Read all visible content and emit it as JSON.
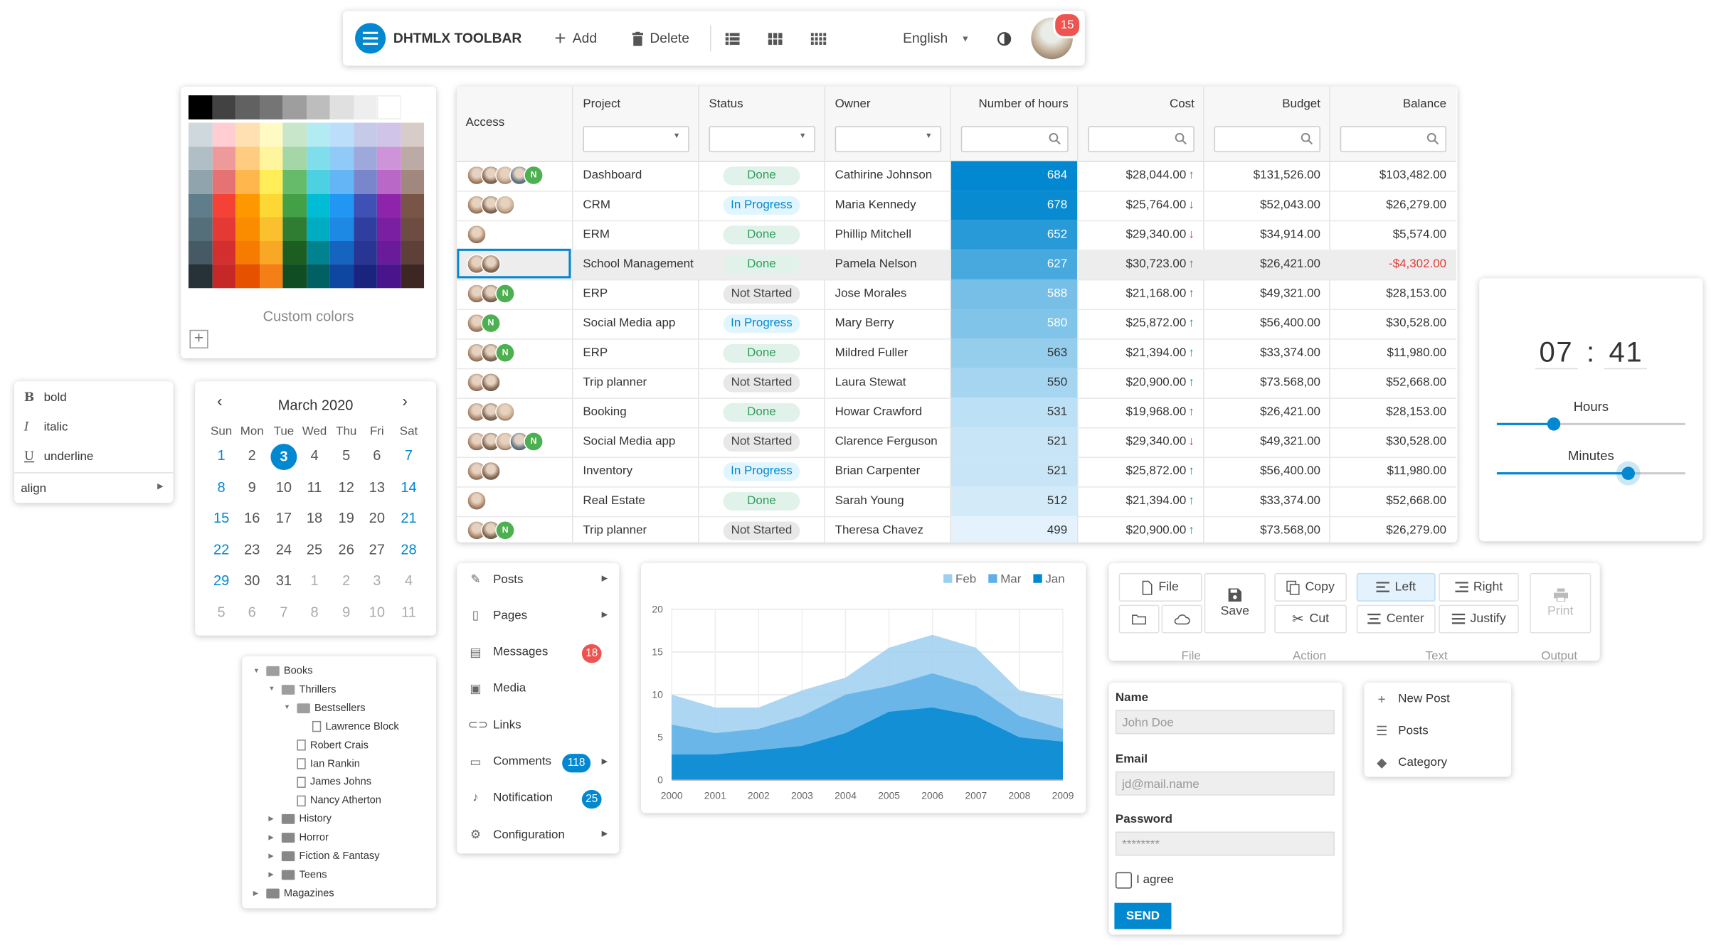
{
  "toolbar": {
    "title": "DHTMLX TOOLBAR",
    "add": "Add",
    "delete": "Delete",
    "language": "English",
    "notifications": "15"
  },
  "colorpicker": {
    "custom_colors": "Custom colors",
    "grays": [
      "#000000",
      "#424242",
      "#616161",
      "#757575",
      "#9e9e9e",
      "#bdbdbd",
      "#e0e0e0",
      "#eeeeee",
      "#ffffff"
    ],
    "palette": [
      [
        "#cfd8dc",
        "#ffcdd2",
        "#ffe0b2",
        "#fff9c4",
        "#c8e6c9",
        "#b2ebf2",
        "#bbdefb",
        "#c5cae9",
        "#d1c4e9",
        "#d7ccc8"
      ],
      [
        "#b0bec5",
        "#ef9a9a",
        "#ffcc80",
        "#fff59d",
        "#a5d6a7",
        "#80deea",
        "#90caf9",
        "#9fa8da",
        "#ce93d8",
        "#bcaaa4"
      ],
      [
        "#90a4ae",
        "#e57373",
        "#ffb74d",
        "#ffee58",
        "#66bb6a",
        "#4dd0e1",
        "#64b5f6",
        "#7986cb",
        "#ba68c8",
        "#a1887f"
      ],
      [
        "#607d8b",
        "#f44336",
        "#ff9800",
        "#fdd835",
        "#43a047",
        "#00bcd4",
        "#2196f3",
        "#3f51b5",
        "#8e24aa",
        "#795548"
      ],
      [
        "#546e7a",
        "#e53935",
        "#fb8c00",
        "#fbc02d",
        "#2e7d32",
        "#00acc1",
        "#1e88e5",
        "#303f9f",
        "#7b1fa2",
        "#6d4c41"
      ],
      [
        "#455a64",
        "#d32f2f",
        "#f57c00",
        "#f9a825",
        "#1b5e20",
        "#00838f",
        "#1565c0",
        "#283593",
        "#6a1b9a",
        "#5d4037"
      ],
      [
        "#263238",
        "#c62828",
        "#e65100",
        "#f57f17",
        "#104d22",
        "#006064",
        "#0d47a1",
        "#1a237e",
        "#4a148c",
        "#3e2723"
      ]
    ]
  },
  "grid": {
    "headers": [
      "Access",
      "Project",
      "Status",
      "Owner",
      "Number of hours",
      "Cost",
      "Budget",
      "Balance"
    ],
    "rows": [
      {
        "avatars": 4,
        "n": true,
        "project": "Dashboard",
        "status": "Done",
        "owner": "Cathirine Johnson",
        "hours": "684",
        "cost": "$28,044.00",
        "trend": "up",
        "budget": "$131,526.00",
        "balance": "$103,482.00"
      },
      {
        "avatars": 3,
        "n": false,
        "project": "CRM",
        "status": "In Progress",
        "owner": "Maria Kennedy",
        "hours": "678",
        "cost": "$25,764.00",
        "trend": "down",
        "budget": "$52,043.00",
        "balance": "$26,279.00"
      },
      {
        "avatars": 1,
        "n": false,
        "project": "ERM",
        "status": "Done",
        "owner": "Phillip Mitchell",
        "hours": "652",
        "cost": "$29,340.00",
        "trend": "down",
        "budget": "$34,914.00",
        "balance": "$5,574.00"
      },
      {
        "avatars": 2,
        "n": false,
        "project": "School Management",
        "status": "Done",
        "owner": "Pamela Nelson",
        "hours": "627",
        "cost": "$30,723.00",
        "trend": "up",
        "budget": "$26,421.00",
        "balance": "-$4,302.00"
      },
      {
        "avatars": 2,
        "n": true,
        "project": "ERP",
        "status": "Not Started",
        "owner": "Jose Morales",
        "hours": "588",
        "cost": "$21,168.00",
        "trend": "up",
        "budget": "$49,321.00",
        "balance": "$28,153.00"
      },
      {
        "avatars": 1,
        "n": true,
        "project": "Social Media app",
        "status": "In Progress",
        "owner": "Mary Berry",
        "hours": "580",
        "cost": "$25,872.00",
        "trend": "up",
        "budget": "$56,400.00",
        "balance": "$30,528.00"
      },
      {
        "avatars": 2,
        "n": true,
        "project": "ERP",
        "status": "Done",
        "owner": "Mildred Fuller",
        "hours": "563",
        "cost": "$21,394.00",
        "trend": "up",
        "budget": "$33,374.00",
        "balance": "$11,980.00"
      },
      {
        "avatars": 2,
        "n": false,
        "project": "Trip planner",
        "status": "Not Started",
        "owner": "Laura Stewat",
        "hours": "550",
        "cost": "$20,900.00",
        "trend": "up",
        "budget": "$73.568,00",
        "balance": "$52,668.00"
      },
      {
        "avatars": 3,
        "n": false,
        "project": "Booking",
        "status": "Done",
        "owner": "Howar Crawford",
        "hours": "531",
        "cost": "$19,968.00",
        "trend": "up",
        "budget": "$26,421.00",
        "balance": "$28,153.00"
      },
      {
        "avatars": 4,
        "n": true,
        "project": "Social Media app",
        "status": "Not Started",
        "owner": "Clarence Ferguson",
        "hours": "521",
        "cost": "$29,340.00",
        "trend": "down",
        "budget": "$49,321.00",
        "balance": "$30,528.00"
      },
      {
        "avatars": 2,
        "n": false,
        "project": "Inventory",
        "status": "In Progress",
        "owner": "Brian Carpenter",
        "hours": "521",
        "cost": "$25,872.00",
        "trend": "up",
        "budget": "$56,400.00",
        "balance": "$11,980.00"
      },
      {
        "avatars": 1,
        "n": false,
        "project": "Real Estate",
        "status": "Done",
        "owner": "Sarah Young",
        "hours": "512",
        "cost": "$21,394.00",
        "trend": "up",
        "budget": "$33,374.00",
        "balance": "$52,668.00"
      },
      {
        "avatars": 2,
        "n": true,
        "project": "Trip planner",
        "status": "Not Started",
        "owner": "Theresa Chavez",
        "hours": "499",
        "cost": "$20,900.00",
        "trend": "up",
        "budget": "$73.568,00",
        "balance": "$26,279.00"
      }
    ],
    "n_label": "N",
    "colors": {
      "done_bg": "#e0f2e9",
      "done_fg": "#2e9e5b",
      "progress_bg": "#e1f5fe",
      "progress_fg": "#0288d1",
      "notstarted_bg": "#e8e8e8",
      "notstarted_fg": "#444",
      "up": "#2e9e5b",
      "down": "#e53935",
      "negative": "#e53935"
    }
  },
  "timepicker": {
    "hour": "07",
    "minute": "41",
    "separator": ":",
    "hours_label": "Hours",
    "minutes_label": "Minutes",
    "hour_value": 7,
    "minute_value": 41
  },
  "context_menu": {
    "items": [
      {
        "key": "B",
        "label": "bold"
      },
      {
        "key": "I",
        "label": "italic"
      },
      {
        "key": "U",
        "label": "underline"
      }
    ],
    "align": "align"
  },
  "calendar": {
    "month": "March 2020",
    "dow": [
      "Sun",
      "Mon",
      "Tue",
      "Wed",
      "Thu",
      "Fri",
      "Sat"
    ],
    "weeks": [
      [
        "1",
        "2",
        "3",
        "4",
        "5",
        "6",
        "7"
      ],
      [
        "8",
        "9",
        "10",
        "11",
        "12",
        "13",
        "14"
      ],
      [
        "15",
        "16",
        "17",
        "18",
        "19",
        "20",
        "21"
      ],
      [
        "22",
        "23",
        "24",
        "25",
        "26",
        "27",
        "28"
      ],
      [
        "29",
        "30",
        "31",
        "1",
        "2",
        "3",
        "4"
      ],
      [
        "5",
        "6",
        "7",
        "8",
        "9",
        "10",
        "11"
      ]
    ],
    "selected": "3"
  },
  "tree": {
    "items": [
      {
        "label": "Books",
        "level": 0,
        "type": "folder-open",
        "arrow": "down"
      },
      {
        "label": "Thrillers",
        "level": 1,
        "type": "folder-open",
        "arrow": "down"
      },
      {
        "label": "Bestsellers",
        "level": 2,
        "type": "folder-open",
        "arrow": "down"
      },
      {
        "label": "Lawrence Block",
        "level": 3,
        "type": "file",
        "arrow": ""
      },
      {
        "label": "Robert Crais",
        "level": 2,
        "type": "file",
        "arrow": ""
      },
      {
        "label": "Ian Rankin",
        "level": 2,
        "type": "file",
        "arrow": ""
      },
      {
        "label": "James Johns",
        "level": 2,
        "type": "file",
        "arrow": ""
      },
      {
        "label": "Nancy Atherton",
        "level": 2,
        "type": "file",
        "arrow": ""
      },
      {
        "label": "History",
        "level": 1,
        "type": "folder",
        "arrow": "right"
      },
      {
        "label": "Horror",
        "level": 1,
        "type": "folder",
        "arrow": "right"
      },
      {
        "label": "Fiction & Fantasy",
        "level": 1,
        "type": "folder",
        "arrow": "right"
      },
      {
        "label": "Teens",
        "level": 1,
        "type": "folder",
        "arrow": "right"
      },
      {
        "label": "Magazines",
        "level": 0,
        "type": "folder",
        "arrow": "right"
      }
    ]
  },
  "sidebar": {
    "items": [
      {
        "label": "Posts",
        "icon": "edit-icon",
        "arrow": true
      },
      {
        "label": "Pages",
        "icon": "page-icon",
        "arrow": true
      },
      {
        "label": "Messages",
        "icon": "inbox-icon",
        "badge": "18",
        "badge_color": "#ef5350"
      },
      {
        "label": "Media",
        "icon": "image-icon"
      },
      {
        "label": "Links",
        "icon": "link-icon"
      },
      {
        "label": "Comments",
        "icon": "comment-icon",
        "badge": "118",
        "badge_color": "#0288d1",
        "arrow": true
      },
      {
        "label": "Notification",
        "icon": "bell-icon",
        "badge": "25",
        "badge_color": "#0288d1"
      },
      {
        "label": "Configuration",
        "icon": "gear-icon",
        "arrow": true
      }
    ]
  },
  "chart_data": {
    "type": "area",
    "x": [
      "2000",
      "2001",
      "2002",
      "2003",
      "2004",
      "2005",
      "2006",
      "2007",
      "2008",
      "2009"
    ],
    "series": [
      {
        "name": "Feb",
        "color": "#9dcff0",
        "values": [
          10,
          8.5,
          8.5,
          10.5,
          12,
          15.5,
          17,
          15.5,
          10.5,
          9.5
        ]
      },
      {
        "name": "Mar",
        "color": "#5fb0e8",
        "values": [
          6.5,
          5.5,
          6,
          7.5,
          10,
          11,
          12.5,
          11,
          7.5,
          6
        ]
      },
      {
        "name": "Jan",
        "color": "#0288d1",
        "values": [
          3,
          3,
          3.5,
          4,
          5.5,
          8,
          8.5,
          7.5,
          5,
          4.5
        ]
      }
    ],
    "legend_order": [
      "Feb",
      "Mar",
      "Jan"
    ],
    "ylim": [
      0,
      20
    ],
    "yticks": [
      "20",
      "15",
      "10",
      "5",
      "0"
    ],
    "legend": "top-right",
    "grid": true
  },
  "ribbon": {
    "file": "File",
    "save": "Save",
    "copy": "Copy",
    "cut": "Cut",
    "left": "Left",
    "right": "Right",
    "center": "Center",
    "justify": "Justify",
    "print": "Print",
    "groups": [
      "File",
      "Action",
      "Text",
      "Output"
    ]
  },
  "form": {
    "name_label": "Name",
    "name_placeholder": "John Doe",
    "email_label": "Email",
    "email_placeholder": "jd@mail.name",
    "password_label": "Password",
    "password_value": "********",
    "agree": "I agree",
    "send": "SEND"
  },
  "add_menu": {
    "items": [
      {
        "label": "New Post",
        "icon": "plus-icon"
      },
      {
        "label": "Posts",
        "icon": "list-icon"
      },
      {
        "label": "Category",
        "icon": "tag-icon"
      }
    ]
  }
}
